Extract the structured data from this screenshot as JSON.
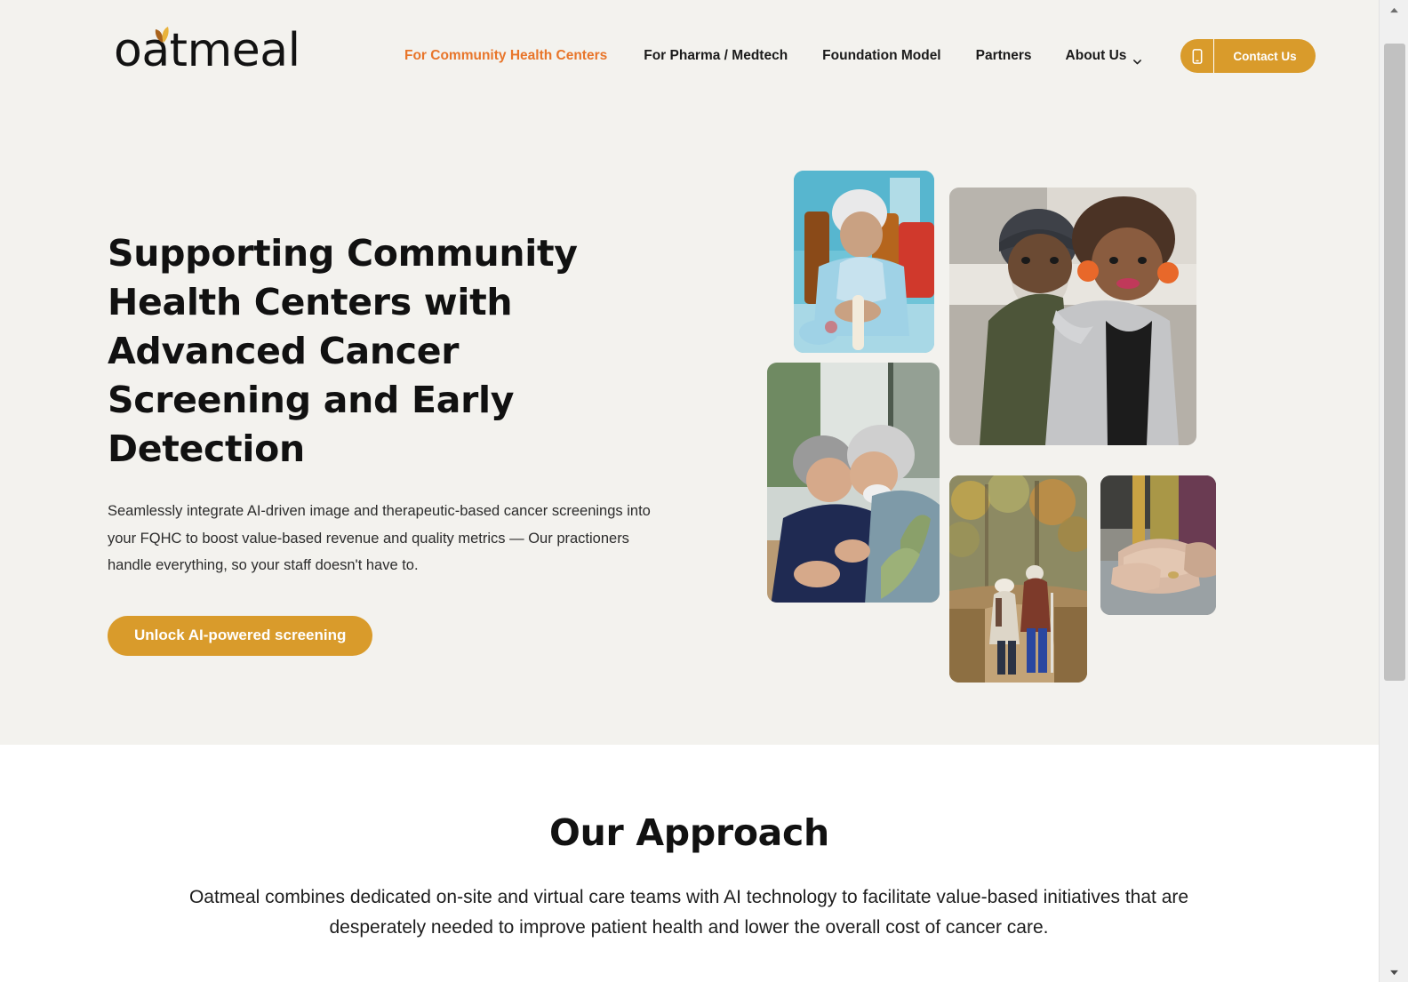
{
  "brand": {
    "name": "oatmeal",
    "leaf_light": "#E9B33C",
    "leaf_dark": "#A9621B"
  },
  "colors": {
    "hero_background": "#F3F2EE",
    "page_background": "#FFFFFF",
    "accent_gold": "#D99B2B",
    "accent_orange": "#E8752A",
    "text_dark": "#111111"
  },
  "nav": {
    "items": [
      {
        "label": "For Community Health Centers",
        "active": true,
        "has_caret": false
      },
      {
        "label": "For Pharma / Medtech",
        "active": false,
        "has_caret": false
      },
      {
        "label": "Foundation Model",
        "active": false,
        "has_caret": false
      },
      {
        "label": "Partners",
        "active": false,
        "has_caret": false
      },
      {
        "label": "About Us",
        "active": false,
        "has_caret": true
      }
    ],
    "contact_button": {
      "label": "Contact Us",
      "icon": "mobile-phone-icon"
    }
  },
  "hero": {
    "title": "Supporting Community Health Centers with Advanced Cancer Screening and Early Detection",
    "subtitle": "Seamlessly integrate AI-driven image and therapeutic-based cancer screenings into your FQHC to boost value-based revenue and quality metrics — Our practioners handle everything, so your staff doesn't have to.",
    "cta_label": "Unlock AI-powered screening",
    "photos": [
      {
        "alt": "Elderly woman in blue smock seated against teal wall"
      },
      {
        "alt": "Older couple laughing together beside houseplants"
      },
      {
        "alt": "Smiling older couple outdoors, man in beanie and woman with curly hair"
      },
      {
        "alt": "Older couple walking away on an autumn forest path with a cane"
      },
      {
        "alt": "Close-up of clasped elderly hands resting on a lap"
      }
    ]
  },
  "approach": {
    "title": "Our Approach",
    "body": "Oatmeal combines dedicated on-site and virtual care teams with AI technology to facilitate value-based initiatives that are desperately needed to improve patient health and lower the overall cost of cancer care."
  },
  "scrollbar": {
    "up_arrow": "scroll-up-arrow-icon",
    "down_arrow": "scroll-down-arrow-icon"
  }
}
